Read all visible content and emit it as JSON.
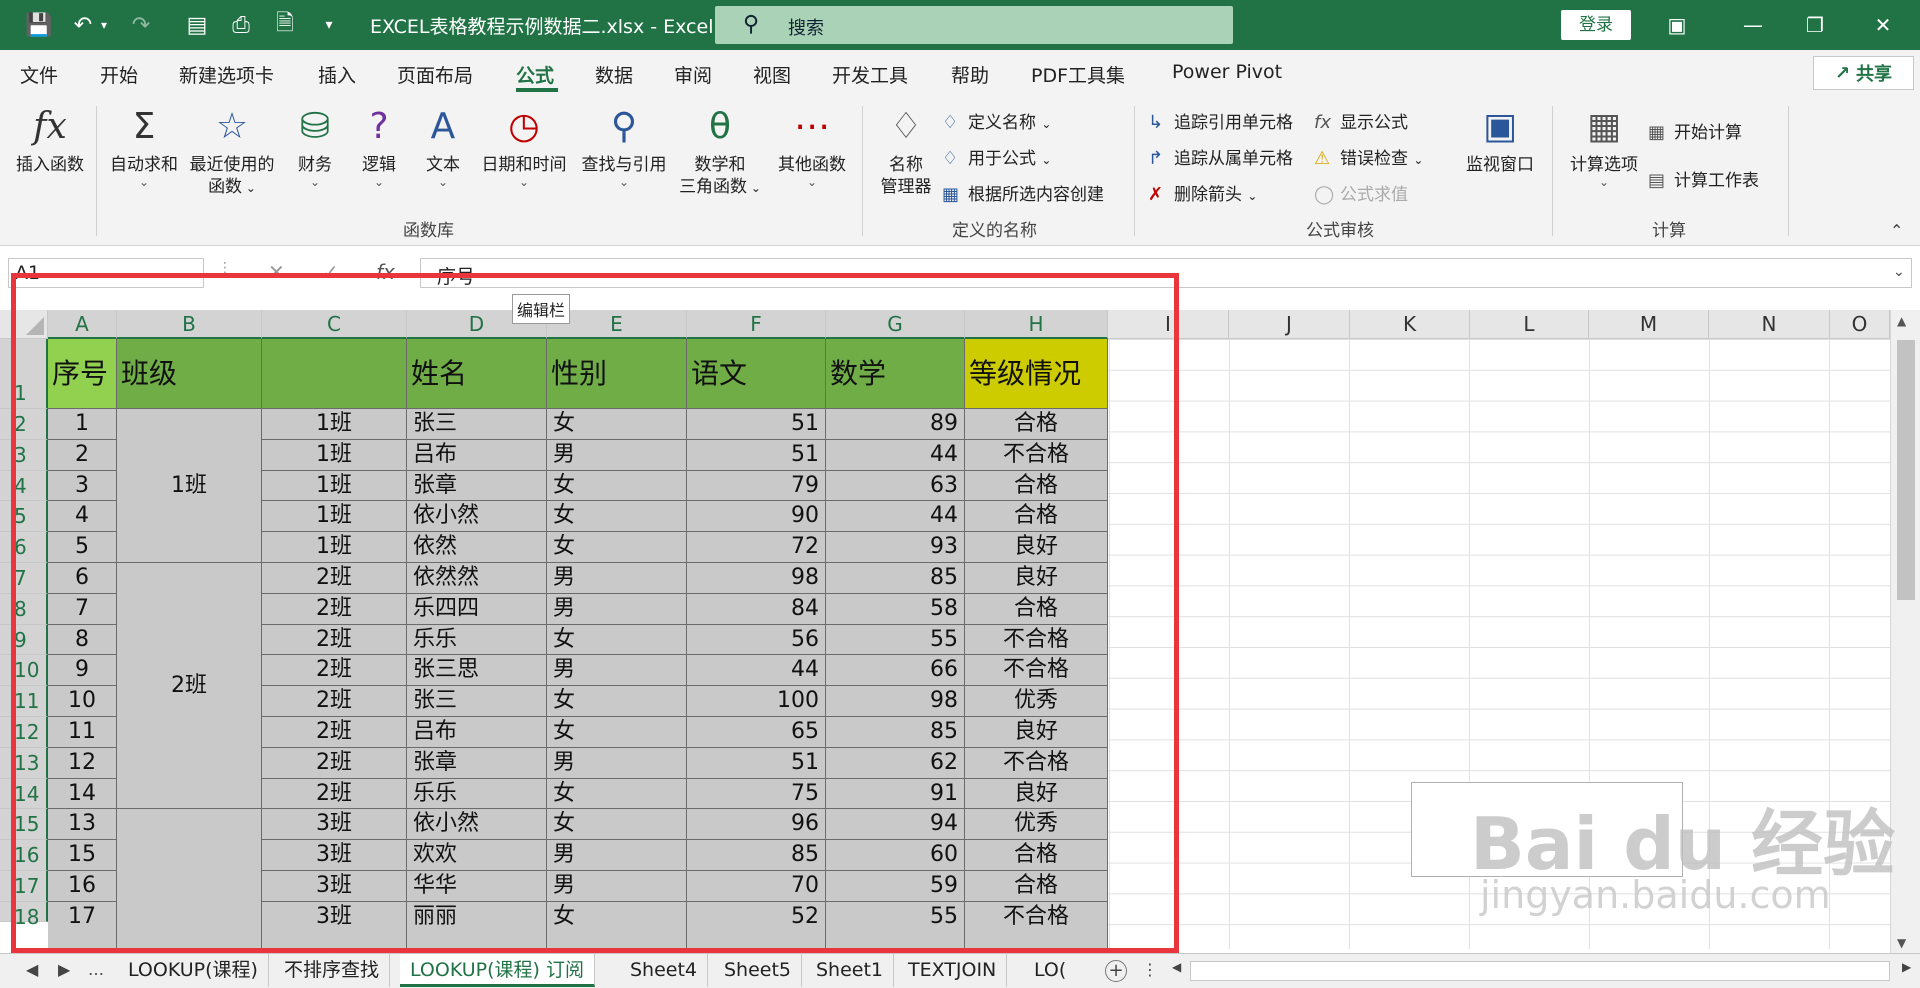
{
  "titlebar": {
    "filename": "EXCEL表格教程示例数据二.xlsx  -  Excel",
    "search_placeholder": "搜索",
    "login": "登录"
  },
  "menu": [
    "文件",
    "开始",
    "新建选项卡",
    "插入",
    "页面布局",
    "公式",
    "数据",
    "审阅",
    "视图",
    "开发工具",
    "帮助",
    "PDF工具集",
    "Power Pivot"
  ],
  "share": "共享",
  "ribbon": {
    "insert_function": "插入函数",
    "autosum": "自动求和",
    "recent1": "最近使用的",
    "recent2": "函数",
    "finance": "财务",
    "logic": "逻辑",
    "text": "文本",
    "datetime": "日期和时间",
    "lookup": "查找与引用",
    "math1": "数学和",
    "math2": "三角函数",
    "other": "其他函数",
    "group_library": "函数库",
    "name_mgr1": "名称",
    "name_mgr2": "管理器",
    "define_name": "定义名称",
    "use_in_formula": "用于公式",
    "create_from_sel": "根据所选内容创建",
    "group_names": "定义的名称",
    "trace_precedents": "追踪引用单元格",
    "trace_dependents": "追踪从属单元格",
    "remove_arrows": "删除箭头",
    "show_formulas": "显示公式",
    "error_checking": "错误检查",
    "evaluate": "公式求值",
    "watch_window": "监视窗口",
    "group_audit": "公式审核",
    "calc_options": "计算选项",
    "calc_now": "开始计算",
    "calc_sheet": "计算工作表",
    "group_calc": "计算"
  },
  "formula_bar": {
    "name_box": "A1",
    "fx": "fx",
    "content": "序号",
    "tooltip": "编辑栏"
  },
  "columns": [
    "A",
    "B",
    "C",
    "D",
    "E",
    "F",
    "G",
    "H",
    "I",
    "J",
    "K",
    "L",
    "M",
    "N",
    "O"
  ],
  "headers": {
    "seq": "序号",
    "class_b": "班级",
    "name": "姓名",
    "gender": "性别",
    "chinese": "语文",
    "math": "数学",
    "grade": "等级情况"
  },
  "merged_classes": [
    "1班",
    "2班"
  ],
  "rows": [
    {
      "n": "1",
      "cls": "1班",
      "name": "张三",
      "g": "女",
      "cn": "51",
      "ma": "89",
      "lv": "合格"
    },
    {
      "n": "2",
      "cls": "1班",
      "name": "吕布",
      "g": "男",
      "cn": "51",
      "ma": "44",
      "lv": "不合格"
    },
    {
      "n": "3",
      "cls": "1班",
      "name": "张章",
      "g": "女",
      "cn": "79",
      "ma": "63",
      "lv": "合格"
    },
    {
      "n": "4",
      "cls": "1班",
      "name": "依小然",
      "g": "女",
      "cn": "90",
      "ma": "44",
      "lv": "合格"
    },
    {
      "n": "5",
      "cls": "1班",
      "name": "依然",
      "g": "女",
      "cn": "72",
      "ma": "93",
      "lv": "良好"
    },
    {
      "n": "6",
      "cls": "2班",
      "name": "依然然",
      "g": "男",
      "cn": "98",
      "ma": "85",
      "lv": "良好"
    },
    {
      "n": "7",
      "cls": "2班",
      "name": "乐四四",
      "g": "男",
      "cn": "84",
      "ma": "58",
      "lv": "合格"
    },
    {
      "n": "8",
      "cls": "2班",
      "name": "乐乐",
      "g": "女",
      "cn": "56",
      "ma": "55",
      "lv": "不合格"
    },
    {
      "n": "9",
      "cls": "2班",
      "name": "张三思",
      "g": "男",
      "cn": "44",
      "ma": "66",
      "lv": "不合格"
    },
    {
      "n": "10",
      "cls": "2班",
      "name": "张三",
      "g": "女",
      "cn": "100",
      "ma": "98",
      "lv": "优秀"
    },
    {
      "n": "11",
      "cls": "2班",
      "name": "吕布",
      "g": "女",
      "cn": "65",
      "ma": "85",
      "lv": "良好"
    },
    {
      "n": "12",
      "cls": "2班",
      "name": "张章",
      "g": "男",
      "cn": "51",
      "ma": "62",
      "lv": "不合格"
    },
    {
      "n": "14",
      "cls": "2班",
      "name": "乐乐",
      "g": "女",
      "cn": "75",
      "ma": "91",
      "lv": "良好"
    },
    {
      "n": "13",
      "cls": "3班",
      "name": "依小然",
      "g": "女",
      "cn": "96",
      "ma": "94",
      "lv": "优秀"
    },
    {
      "n": "15",
      "cls": "3班",
      "name": "欢欢",
      "g": "男",
      "cn": "85",
      "ma": "60",
      "lv": "合格"
    },
    {
      "n": "16",
      "cls": "3班",
      "name": "华华",
      "g": "男",
      "cn": "70",
      "ma": "59",
      "lv": "合格"
    },
    {
      "n": "17",
      "cls": "3班",
      "name": "丽丽",
      "g": "女",
      "cn": "52",
      "ma": "55",
      "lv": "不合格"
    }
  ],
  "row_numbers": [
    "1",
    "2",
    "3",
    "4",
    "5",
    "6",
    "7",
    "8",
    "9",
    "10",
    "11",
    "12",
    "13",
    "14",
    "15",
    "16",
    "17",
    "18"
  ],
  "sheets": [
    "LOOKUP(课程)",
    "不排序查找",
    "LOOKUP(课程) 订阅",
    "Sheet4",
    "Sheet5",
    "Sheet1",
    "TEXTJOIN",
    "LO("
  ],
  "active_sheet": "LOOKUP(课程) 订阅",
  "colors": {
    "accent": "#217346",
    "header_green": "#70ad47",
    "header_yellow": "#cccc00",
    "highlight_frame": "#e8363c"
  },
  "watermark": {
    "brand": "Bai du 经验",
    "url": "jingyan.baidu.com"
  }
}
